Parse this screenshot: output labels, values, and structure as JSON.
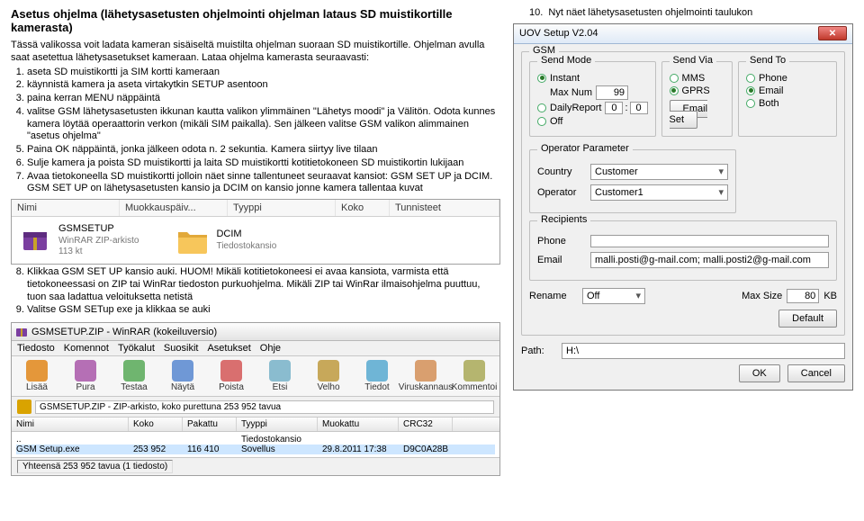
{
  "title": "Asetus ohjelma (lähetysasetusten ohjelmointi ohjelman lataus SD muistikortille kamerasta)",
  "intro": "Tässä valikossa voit ladata kameran sisäiseltä muistilta ohjelman suoraan SD muistikortille. Ohjelman avulla saat asetettua lähetysasetukset kameraan. Lataa ohjelma kamerasta seuraavasti:",
  "steps": [
    "aseta SD muistikortti ja SIM kortti kameraan",
    "käynnistä kamera ja aseta virtakytkin SETUP asentoon",
    "paina kerran MENU näppäintä",
    "valitse GSM lähetysasetusten ikkunan kautta valikon ylimmäinen \"Lähetys moodi\" ja Välitön. Odota kunnes kamera löytää operaattorin verkon (mikäli SIM paikalla). Sen jälkeen valitse GSM valikon alimmainen \"asetus ohjelma\"",
    "Paina OK näppäintä, jonka jälkeen odota n. 2 sekuntia. Kamera siirtyy live tilaan",
    "Sulje kamera ja poista SD muistikortti ja laita SD muistikortti kotitietokoneen SD muistikortin lukijaan",
    "Avaa tietokoneella SD muistikortti jolloin näet sinne tallentuneet seuraavat kansiot: GSM SET UP ja DCIM."
  ],
  "steps_note": "GSM SET UP on lähetysasetusten kansio ja DCIM on kansio jonne kamera tallentaa kuvat",
  "step8": "Klikkaa GSM SET UP kansio auki. HUOM! Mikäli kotitietokoneesi ei avaa kansiota, varmista että tietokoneessasi on ZIP tai WinRar tiedoston purkuohjelma. Mikäli ZIP tai WinRar ilmaisohjelma puuttuu, tuon saa ladattua veloituksetta netistä",
  "step9": "Valitse GSM SETup exe ja klikkaa se auki",
  "step10": "Nyt näet lähetysasetusten ohjelmointi taulukon",
  "explorer": {
    "headers": {
      "name": "Nimi",
      "mod": "Muokkauspäiv...",
      "type": "Tyyppi",
      "size": "Koko",
      "tags": "Tunnisteet"
    },
    "item1": {
      "name": "GSMSETUP",
      "type": "WinRAR ZIP-arkisto",
      "size": "113 kt"
    },
    "item2": {
      "name": "DCIM",
      "type": "Tiedostokansio"
    }
  },
  "winrar": {
    "title": "GSMSETUP.ZIP - WinRAR (kokeiluversio)",
    "menu": [
      "Tiedosto",
      "Komennot",
      "Työkalut",
      "Suosikit",
      "Asetukset",
      "Ohje"
    ],
    "toolbar": [
      "Lisää",
      "Pura",
      "Testaa",
      "Näytä",
      "Poista",
      "Etsi",
      "Velho",
      "Tiedot",
      "Viruskannaus",
      "Kommentoi"
    ],
    "path": "GSMSETUP.ZIP - ZIP-arkisto, koko purettuna 253 952 tavua",
    "cols": {
      "name": "Nimi",
      "size": "Koko",
      "pack": "Pakattu",
      "type": "Tyyppi",
      "mod": "Muokattu",
      "crc": "CRC32"
    },
    "row0": {
      "name": "..",
      "type": "Tiedostokansio"
    },
    "row1": {
      "name": "GSM Setup.exe",
      "size": "253 952",
      "pack": "116 410",
      "type": "Sovellus",
      "mod": "29.8.2011 17:38",
      "crc": "D9C0A28B"
    },
    "status": {
      "sel": "Yhteensä 253 952 tavua (1 tiedosto)"
    }
  },
  "uov": {
    "title": "UOV Setup V2.04",
    "gsm": "GSM",
    "sendmode": {
      "legend": "Send Mode",
      "instant": "Instant",
      "daily": "DailyReport",
      "off": "Off",
      "maxnum_label": "Max Num",
      "maxnum": "99",
      "d1": "0",
      "d2": "0"
    },
    "sendvia": {
      "legend": "Send Via",
      "mms": "MMS",
      "gprs": "GPRS",
      "btn": "Email Set"
    },
    "sendto": {
      "legend": "Send To",
      "phone": "Phone",
      "email": "Email",
      "both": "Both"
    },
    "op": {
      "legend": "Operator Parameter",
      "country_l": "Country",
      "country": "Customer",
      "operator_l": "Operator",
      "operator": "Customer1"
    },
    "recip": {
      "legend": "Recipients",
      "phone_l": "Phone",
      "phone": "",
      "email_l": "Email",
      "email": "malli.posti@g-mail.com; malli.posti2@g-mail.com"
    },
    "rename_l": "Rename",
    "rename": "Off",
    "maxsize_l": "Max Size",
    "maxsize": "80",
    "kb": "KB",
    "default": "Default",
    "path_l": "Path:",
    "path": "H:\\",
    "ok": "OK",
    "cancel": "Cancel"
  }
}
